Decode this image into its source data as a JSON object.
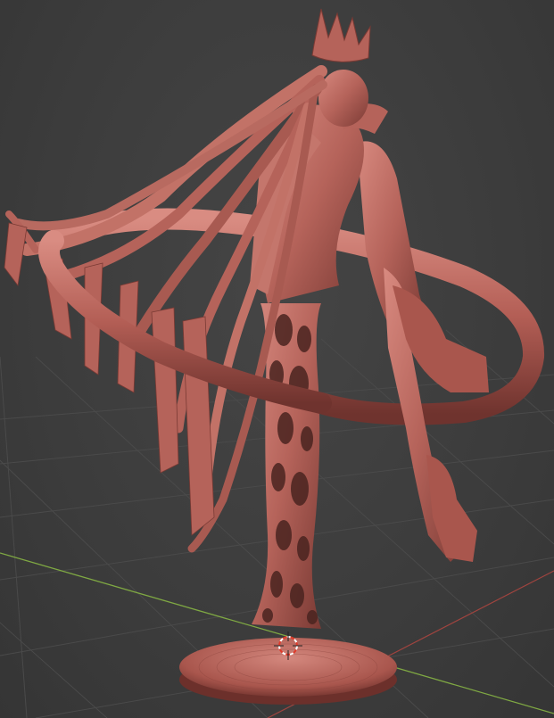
{
  "viewport": {
    "background_color": "#3d3d3d",
    "grid_color": "#4a4a4a",
    "x_axis_color": "#a0443f",
    "y_axis_color": "#7fa843",
    "model_color": "#b5635a",
    "model_shadow_color": "#7a3a34",
    "model_highlight_color": "#d88a80"
  },
  "model": {
    "name_icon": "sculpted-figure",
    "parts": [
      "crown",
      "hair",
      "body",
      "tail-ring",
      "lattice-pillar",
      "boots",
      "base"
    ]
  },
  "origin_marker": {
    "icon": "3d-cursor-icon"
  }
}
